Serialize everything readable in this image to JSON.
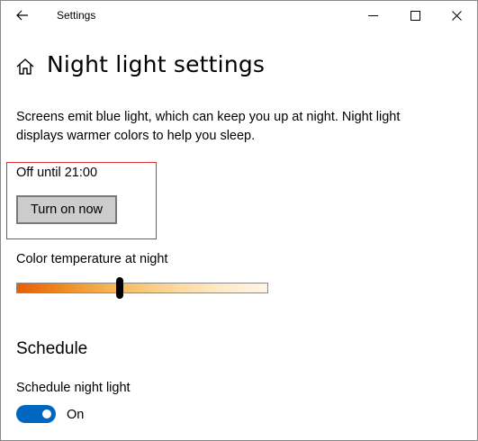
{
  "window": {
    "app_title": "Settings"
  },
  "page": {
    "title": "Night light settings",
    "description": "Screens emit blue light, which can keep you up at night. Night light displays warmer colors to help you sleep."
  },
  "night_light": {
    "status": "Off until 21:00",
    "button_label": "Turn on now"
  },
  "color_temperature": {
    "label": "Color temperature at night",
    "value_fraction": 0.41
  },
  "schedule": {
    "heading": "Schedule",
    "toggle_label": "Schedule night light",
    "toggle_state": "On",
    "toggle_on": true
  },
  "icons": {
    "back": "back-arrow-icon",
    "home": "home-icon",
    "minimize": "minimize-icon",
    "maximize": "maximize-icon",
    "close": "close-icon"
  },
  "colors": {
    "accent": "#0067c0",
    "highlight_border": "#d9302f",
    "button_bg": "#cccccc"
  }
}
